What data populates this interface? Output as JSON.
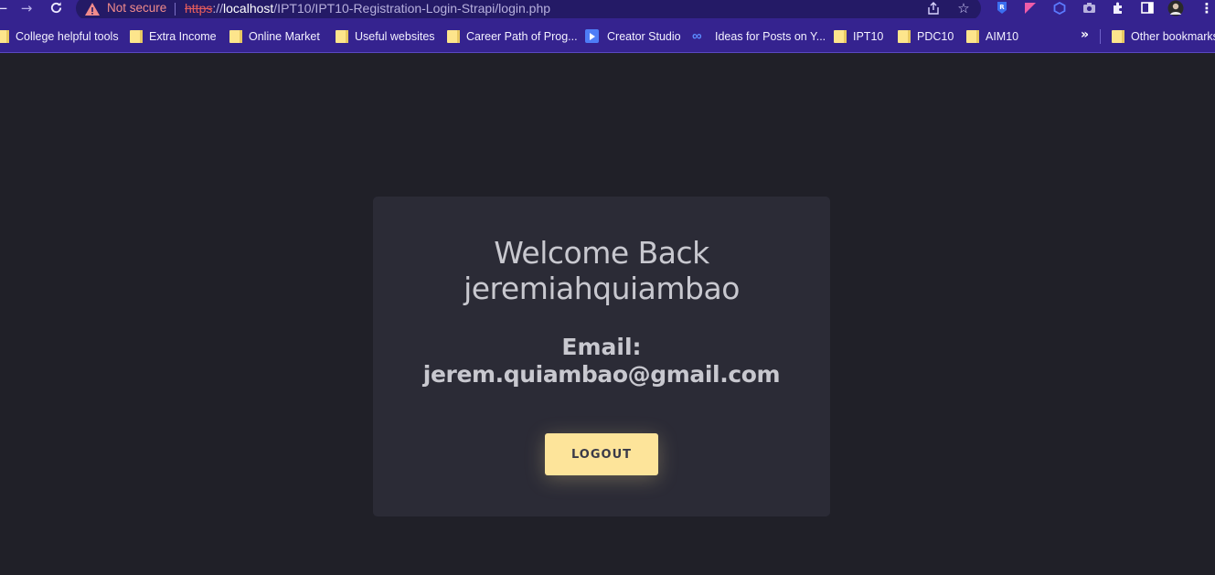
{
  "browser": {
    "security_label": "Not secure",
    "url": {
      "scheme": "https",
      "separator": "://",
      "host": "localhost",
      "path": "/IPT10/IPT10-Registration-Login-Strapi/login.php"
    },
    "nav_icons": [
      "back-arrow-icon",
      "forward-arrow-icon",
      "reload-icon"
    ],
    "omnibox_icons": [
      "share-icon",
      "star-icon"
    ],
    "extension_icons": [
      "extension-icon",
      "extension-icon",
      "extension-icon",
      "camera-icon",
      "puzzle-icon",
      "side-panel-icon",
      "profile-avatar",
      "menu-icon"
    ]
  },
  "bookmarks": {
    "items": [
      {
        "label": "College helpful tools",
        "icon": "folder-icon"
      },
      {
        "label": "Extra Income",
        "icon": "folder-icon"
      },
      {
        "label": "Online Market",
        "icon": "folder-icon"
      },
      {
        "label": "Useful websites",
        "icon": "folder-icon"
      },
      {
        "label": "Career Path of Prog...",
        "icon": "folder-icon"
      },
      {
        "label": "Creator Studio",
        "icon": "creator-studio-icon"
      },
      {
        "label": "Ideas for Posts on Y...",
        "icon": "meta-icon"
      },
      {
        "label": "IPT10",
        "icon": "folder-icon"
      },
      {
        "label": "PDC10",
        "icon": "folder-icon"
      },
      {
        "label": "AIM10",
        "icon": "folder-icon"
      }
    ],
    "more": "»",
    "other": "Other bookmarks"
  },
  "card": {
    "welcome_line1": "Welcome Back",
    "welcome_line2": "jeremiahquiambao",
    "email_label": "Email:",
    "email_value": "jerem.quiambao@gmail.com",
    "logout_label": "LOGOUT"
  },
  "colors": {
    "chrome": "#35238f",
    "omnibox": "#241a66",
    "page_bg": "#202028",
    "card_bg": "#2b2b36",
    "button": "#fde49a"
  }
}
